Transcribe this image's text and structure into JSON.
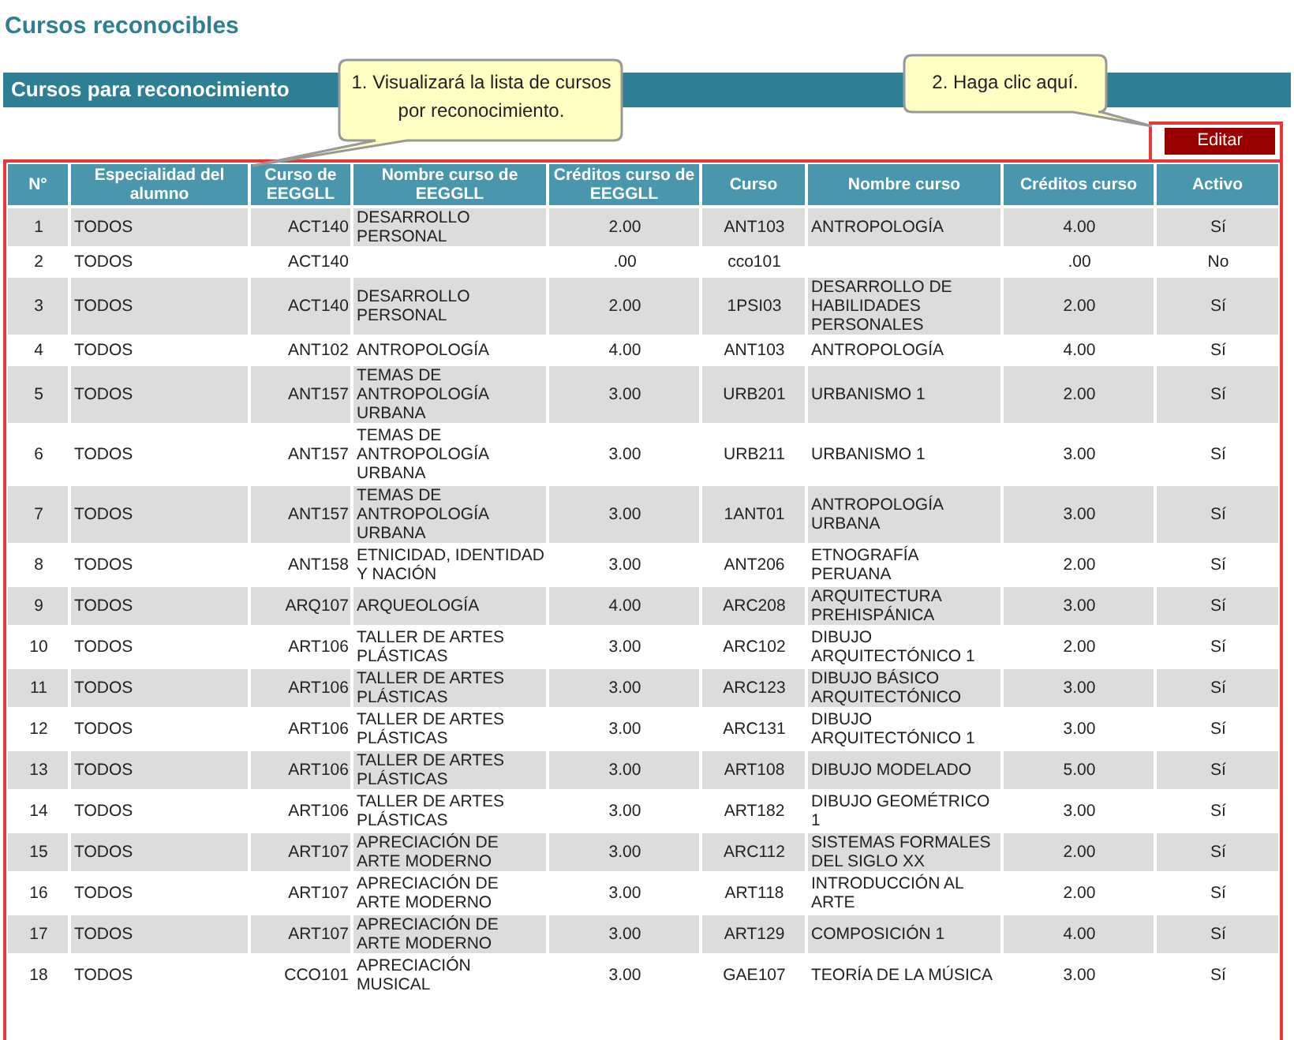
{
  "page_title": "Cursos reconocibles",
  "section_title": "Cursos para reconocimiento",
  "callouts": [
    "1. Visualizará la lista de cursos por reconocimiento.",
    "2. Haga clic aquí."
  ],
  "edit_button": "Editar",
  "table": {
    "columns": [
      "N°",
      "Especialidad del alumno",
      "Curso de EEGGLL",
      "Nombre curso de EEGGLL",
      "Créditos curso de EEGGLL",
      "Curso",
      "Nombre curso",
      "Créditos curso",
      "Activo"
    ],
    "rows": [
      {
        "n": "1",
        "especialidad": "TODOS",
        "curso_eeggll": "ACT140",
        "nombre_eeggll": "DESARROLLO PERSONAL",
        "creditos_eeggll": "2.00",
        "curso": "ANT103",
        "nombre_curso": "ANTROPOLOGÍA",
        "creditos_curso": "4.00",
        "activo": "Sí"
      },
      {
        "n": "2",
        "especialidad": "TODOS",
        "curso_eeggll": "ACT140",
        "creditos_eeggll": ".00",
        "curso": "cco101",
        "creditos_curso": ".00",
        "activo": "No"
      },
      {
        "n": "3",
        "especialidad": "TODOS",
        "curso_eeggll": "ACT140",
        "nombre_eeggll": "DESARROLLO PERSONAL",
        "creditos_eeggll": "2.00",
        "curso": "1PSI03",
        "nombre_curso": "DESARROLLO DE HABILIDADES PERSONALES",
        "creditos_curso": "2.00",
        "activo": "Sí"
      },
      {
        "n": "4",
        "especialidad": "TODOS",
        "curso_eeggll": "ANT102",
        "nombre_eeggll": "ANTROPOLOGÍA",
        "creditos_eeggll": "4.00",
        "curso": "ANT103",
        "nombre_curso": "ANTROPOLOGÍA",
        "creditos_curso": "4.00",
        "activo": "Sí"
      },
      {
        "n": "5",
        "especialidad": "TODOS",
        "curso_eeggll": "ANT157",
        "nombre_eeggll": "TEMAS DE ANTROPOLOGÍA URBANA",
        "creditos_eeggll": "3.00",
        "curso": "URB201",
        "nombre_curso": "URBANISMO 1",
        "creditos_curso": "2.00",
        "activo": "Sí"
      },
      {
        "n": "6",
        "especialidad": "TODOS",
        "curso_eeggll": "ANT157",
        "nombre_eeggll": "TEMAS DE ANTROPOLOGÍA URBANA",
        "creditos_eeggll": "3.00",
        "curso": "URB211",
        "nombre_curso": "URBANISMO 1",
        "creditos_curso": "3.00",
        "activo": "Sí"
      },
      {
        "n": "7",
        "especialidad": "TODOS",
        "curso_eeggll": "ANT157",
        "nombre_eeggll": "TEMAS DE ANTROPOLOGÍA URBANA",
        "creditos_eeggll": "3.00",
        "curso": "1ANT01",
        "nombre_curso": "ANTROPOLOGÍA URBANA",
        "creditos_curso": "3.00",
        "activo": "Sí"
      },
      {
        "n": "8",
        "especialidad": "TODOS",
        "curso_eeggll": "ANT158",
        "nombre_eeggll": "ETNICIDAD, IDENTIDAD Y NACIÓN",
        "creditos_eeggll": "3.00",
        "curso": "ANT206",
        "nombre_curso": "ETNOGRAFÍA PERUANA",
        "creditos_curso": "2.00",
        "activo": "Sí"
      },
      {
        "n": "9",
        "especialidad": "TODOS",
        "curso_eeggll": "ARQ107",
        "nombre_eeggll": "ARQUEOLOGÍA",
        "creditos_eeggll": "4.00",
        "curso": "ARC208",
        "nombre_curso": "ARQUITECTURA PREHISPÁNICA",
        "creditos_curso": "3.00",
        "activo": "Sí"
      },
      {
        "n": "10",
        "especialidad": "TODOS",
        "curso_eeggll": "ART106",
        "nombre_eeggll": "TALLER DE ARTES PLÁSTICAS",
        "creditos_eeggll": "3.00",
        "curso": "ARC102",
        "nombre_curso": "DIBUJO ARQUITECTÓNICO 1",
        "creditos_curso": "2.00",
        "activo": "Sí"
      },
      {
        "n": "11",
        "especialidad": "TODOS",
        "curso_eeggll": "ART106",
        "nombre_eeggll": "TALLER DE ARTES PLÁSTICAS",
        "creditos_eeggll": "3.00",
        "curso": "ARC123",
        "nombre_curso": "DIBUJO BÁSICO ARQUITECTÓNICO",
        "creditos_curso": "3.00",
        "activo": "Sí"
      },
      {
        "n": "12",
        "especialidad": "TODOS",
        "curso_eeggll": "ART106",
        "nombre_eeggll": "TALLER DE ARTES PLÁSTICAS",
        "creditos_eeggll": "3.00",
        "curso": "ARC131",
        "nombre_curso": "DIBUJO ARQUITECTÓNICO 1",
        "creditos_curso": "3.00",
        "activo": "Sí"
      },
      {
        "n": "13",
        "especialidad": "TODOS",
        "curso_eeggll": "ART106",
        "nombre_eeggll": "TALLER DE ARTES PLÁSTICAS",
        "creditos_eeggll": "3.00",
        "curso": "ART108",
        "nombre_curso": "DIBUJO MODELADO",
        "creditos_curso": "5.00",
        "activo": "Sí"
      },
      {
        "n": "14",
        "especialidad": "TODOS",
        "curso_eeggll": "ART106",
        "nombre_eeggll": "TALLER DE ARTES PLÁSTICAS",
        "creditos_eeggll": "3.00",
        "curso": "ART182",
        "nombre_curso": "DIBUJO GEOMÉTRICO 1",
        "creditos_curso": "3.00",
        "activo": "Sí"
      },
      {
        "n": "15",
        "especialidad": "TODOS",
        "curso_eeggll": "ART107",
        "nombre_eeggll": "APRECIACIÓN DE ARTE MODERNO",
        "creditos_eeggll": "3.00",
        "curso": "ARC112",
        "nombre_curso": "SISTEMAS FORMALES DEL SIGLO XX",
        "creditos_curso": "2.00",
        "activo": "Sí"
      },
      {
        "n": "16",
        "especialidad": "TODOS",
        "curso_eeggll": "ART107",
        "nombre_eeggll": "APRECIACIÓN DE ARTE MODERNO",
        "creditos_eeggll": "3.00",
        "curso": "ART118",
        "nombre_curso": "INTRODUCCIÓN AL ARTE",
        "creditos_curso": "2.00",
        "activo": "Sí"
      },
      {
        "n": "17",
        "especialidad": "TODOS",
        "curso_eeggll": "ART107",
        "nombre_eeggll": "APRECIACIÓN DE ARTE MODERNO",
        "creditos_eeggll": "3.00",
        "curso": "ART129",
        "nombre_curso": "COMPOSICIÓN 1",
        "creditos_curso": "4.00",
        "activo": "Sí"
      },
      {
        "n": "18",
        "especialidad": "TODOS",
        "curso_eeggll": "CCO101",
        "nombre_eeggll": "APRECIACIÓN MUSICAL",
        "creditos_eeggll": "3.00",
        "curso": "GAE107",
        "nombre_curso": "TEORÍA DE LA MÚSICA",
        "creditos_curso": "3.00",
        "activo": "Sí"
      }
    ]
  }
}
